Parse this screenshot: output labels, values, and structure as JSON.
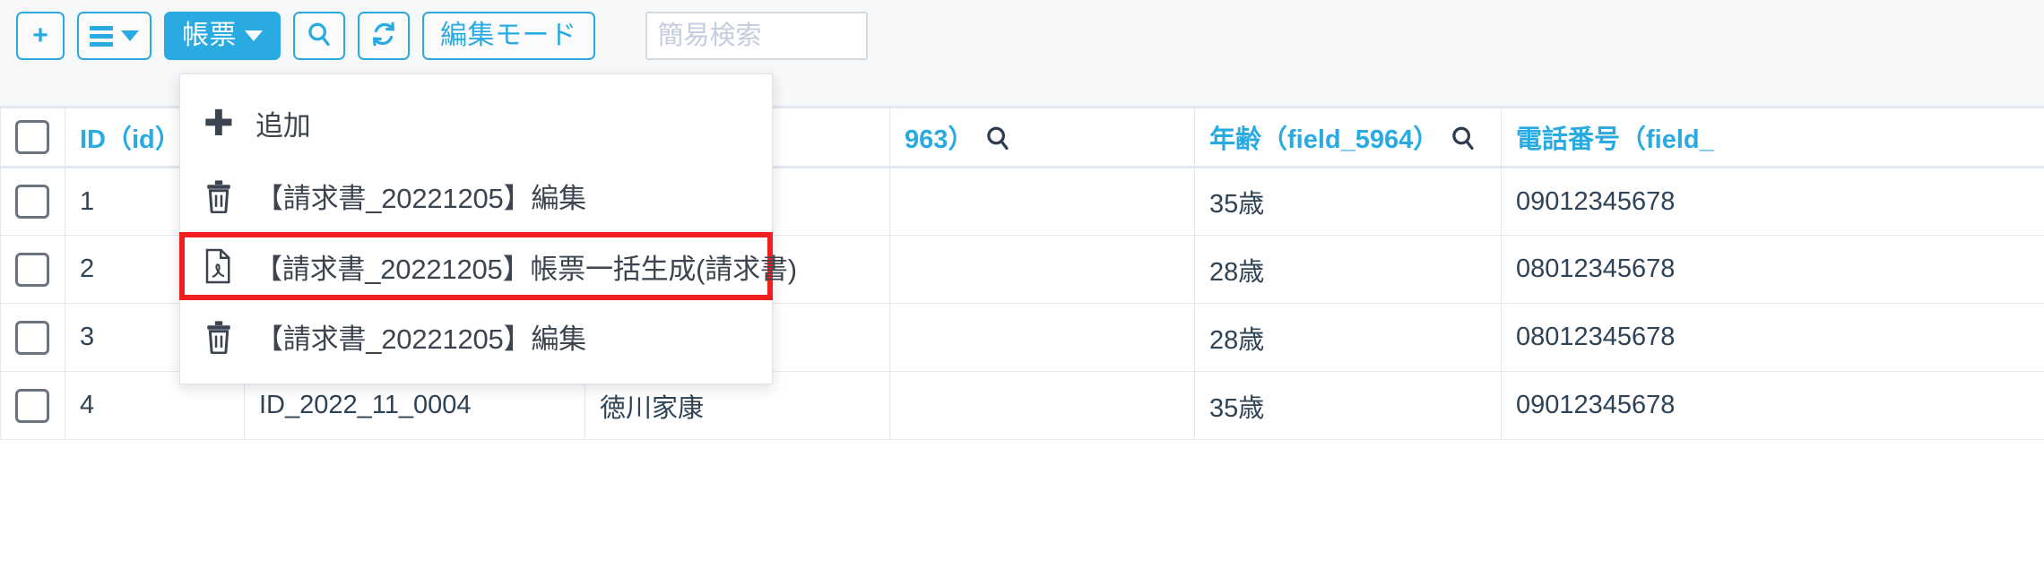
{
  "toolbar": {
    "add_button": "+",
    "menu_button_icon": "hamburger-icon",
    "report_button": "帳票",
    "search_button_icon": "search-icon",
    "refresh_button_icon": "refresh-icon",
    "edit_mode_button": "編集モード",
    "quick_search_placeholder": "簡易検索",
    "quick_search_value": "",
    "accent_color": "#29abe2"
  },
  "dropdown": {
    "items": [
      {
        "icon": "plus-icon",
        "label": "追加",
        "highlighted": false
      },
      {
        "icon": "trash-icon",
        "label": "【請求書_20221205】編集",
        "highlighted": false
      },
      {
        "icon": "pdf-file-icon",
        "label": "【請求書_20221205】帳票一括生成(請求書)",
        "highlighted": true
      },
      {
        "icon": "trash-icon",
        "label": "【請求書_20221205】編集",
        "highlighted": false
      }
    ],
    "highlight_color": "#f01e1e"
  },
  "table": {
    "headers": [
      {
        "label": "",
        "icon": "checkbox",
        "sort": false,
        "search": false
      },
      {
        "label": "ID（id）",
        "icon": "",
        "sort": true,
        "search": false
      },
      {
        "label": "",
        "icon": "",
        "sort": false,
        "search": false
      },
      {
        "label": "",
        "icon": "",
        "sort": false,
        "search": false
      },
      {
        "label": "963）",
        "icon": "",
        "sort": false,
        "search": true
      },
      {
        "label": "年齢（field_5964）",
        "icon": "",
        "sort": false,
        "search": true
      },
      {
        "label": "電話番号（field_",
        "icon": "",
        "sort": false,
        "search": false
      }
    ],
    "rows": [
      {
        "id": "1",
        "col_a": "",
        "col_b": "",
        "col_c": "",
        "age": "35歳",
        "tel": "09012345678"
      },
      {
        "id": "2",
        "col_a": "",
        "col_b": "",
        "col_c": "",
        "age": "28歳",
        "tel": "08012345678"
      },
      {
        "id": "3",
        "col_a": "",
        "col_b": "",
        "col_c": "",
        "age": "28歳",
        "tel": "08012345678"
      },
      {
        "id": "4",
        "col_a": "ID_2022_11_0004",
        "col_b": "徳川家康",
        "col_c": "",
        "age": "35歳",
        "tel": "09012345678"
      }
    ]
  }
}
